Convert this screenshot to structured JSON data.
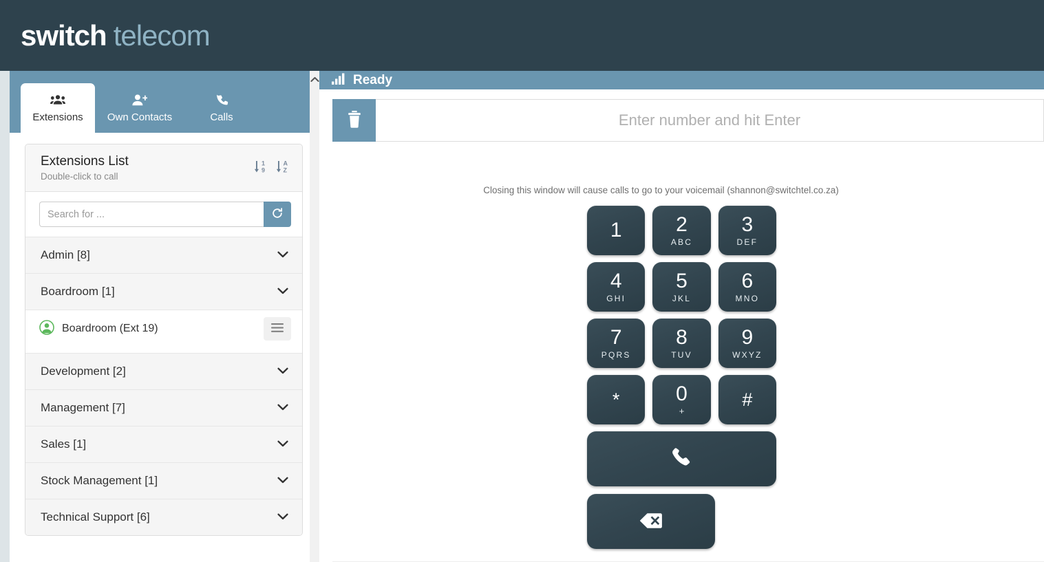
{
  "brand": {
    "word1": "switch",
    "word2": "telecom"
  },
  "tabs": [
    {
      "label": "Extensions",
      "icon": "users-icon",
      "active": true
    },
    {
      "label": "Own Contacts",
      "icon": "user-plus-icon",
      "active": false
    },
    {
      "label": "Calls",
      "icon": "phone-icon",
      "active": false
    }
  ],
  "extensions_panel": {
    "title": "Extensions List",
    "subtitle": "Double-click to call",
    "sort_numeric_icon": "sort-numeric-down-icon",
    "sort_alpha_icon": "sort-alpha-down-icon",
    "search_placeholder": "Search for ...",
    "search_value": "",
    "refresh_icon": "refresh-icon",
    "groups": [
      {
        "label": "Admin [8]",
        "expanded": false,
        "members": []
      },
      {
        "label": "Boardroom [1]",
        "expanded": true,
        "members": [
          {
            "name": "Boardroom (Ext 19)",
            "status": "available",
            "menu_icon": "hamburger-icon"
          }
        ]
      },
      {
        "label": "Development [2]",
        "expanded": false,
        "members": []
      },
      {
        "label": "Management [7]",
        "expanded": false,
        "members": []
      },
      {
        "label": "Sales [1]",
        "expanded": false,
        "members": []
      },
      {
        "label": "Stock Management [1]",
        "expanded": false,
        "members": []
      },
      {
        "label": "Technical Support [6]",
        "expanded": false,
        "members": []
      }
    ]
  },
  "scrollbar": {
    "up_icon": "chevron-up-icon"
  },
  "dialer": {
    "status_icon": "signal-bars-icon",
    "status_text": "Ready",
    "clear_icon": "trash-icon",
    "number_placeholder": "Enter number and hit Enter",
    "number_value": "",
    "voicemail_note": "Closing this window will cause calls to go to your voicemail (shannon@switchtel.co.za)",
    "keys": [
      {
        "digit": "1",
        "letters": ""
      },
      {
        "digit": "2",
        "letters": "ABC"
      },
      {
        "digit": "3",
        "letters": "DEF"
      },
      {
        "digit": "4",
        "letters": "GHI"
      },
      {
        "digit": "5",
        "letters": "JKL"
      },
      {
        "digit": "6",
        "letters": "MNO"
      },
      {
        "digit": "7",
        "letters": "PQRS"
      },
      {
        "digit": "8",
        "letters": "TUV"
      },
      {
        "digit": "9",
        "letters": "WXYZ"
      },
      {
        "digit": "*",
        "letters": ""
      },
      {
        "digit": "0",
        "letters": "+"
      },
      {
        "digit": "#",
        "letters": ""
      }
    ],
    "call_icon": "phone-handset-icon",
    "backspace_icon": "backspace-icon"
  },
  "colors": {
    "header_dark": "#2e424d",
    "accent_blue": "#6a96b0",
    "key_dark": "#32454f",
    "avatar_green": "#5cb85c",
    "panel_gray": "#f5f5f5"
  }
}
